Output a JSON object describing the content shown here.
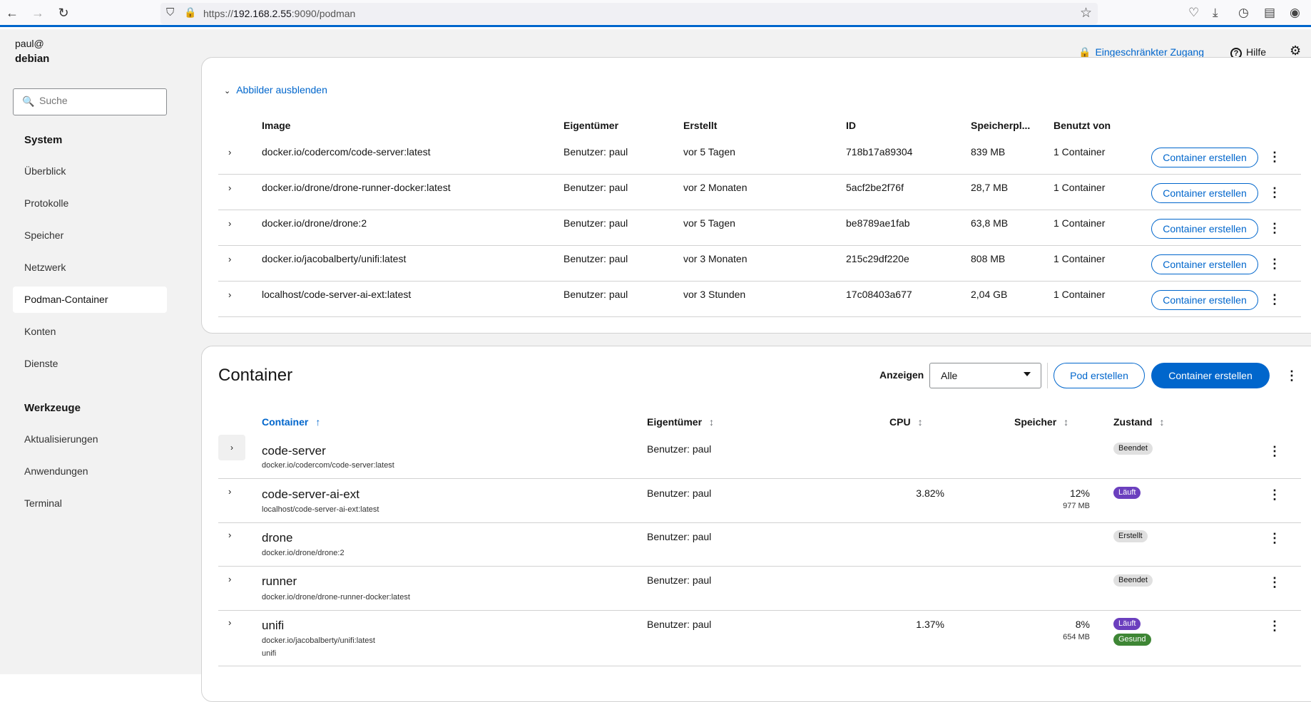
{
  "browser": {
    "url_prefix": "https://",
    "url_host": "192.168.2.55",
    "url_rest": ":9090/podman"
  },
  "header": {
    "user": "paul@",
    "host": "debian",
    "limited_access": "Eingeschränkter Zugang",
    "help": "Hilfe"
  },
  "sidebar": {
    "search_placeholder": "Suche",
    "section_system": "System",
    "items_system": [
      "Überblick",
      "Protokolle",
      "Speicher",
      "Netzwerk",
      "Podman-Container",
      "Konten",
      "Dienste"
    ],
    "section_tools": "Werkzeuge",
    "items_tools": [
      "Aktualisierungen",
      "Anwendungen",
      "Terminal"
    ]
  },
  "images": {
    "toggle_label": "Abbilder ausblenden",
    "columns": [
      "Image",
      "Eigentümer",
      "Erstellt",
      "ID",
      "Speicherpl...",
      "Benutzt von"
    ],
    "create_label": "Container erstellen",
    "rows": [
      {
        "image": "docker.io/codercom/code-server:latest",
        "owner": "Benutzer: paul",
        "created": "vor 5 Tagen",
        "id": "718b17a89304",
        "size": "839 MB",
        "used": "1 Container"
      },
      {
        "image": "docker.io/drone/drone-runner-docker:latest",
        "owner": "Benutzer: paul",
        "created": "vor 2 Monaten",
        "id": "5acf2be2f76f",
        "size": "28,7 MB",
        "used": "1 Container"
      },
      {
        "image": "docker.io/drone/drone:2",
        "owner": "Benutzer: paul",
        "created": "vor 5 Tagen",
        "id": "be8789ae1fab",
        "size": "63,8 MB",
        "used": "1 Container"
      },
      {
        "image": "docker.io/jacobalberty/unifi:latest",
        "owner": "Benutzer: paul",
        "created": "vor 3 Monaten",
        "id": "215c29df220e",
        "size": "808 MB",
        "used": "1 Container"
      },
      {
        "image": "localhost/code-server-ai-ext:latest",
        "owner": "Benutzer: paul",
        "created": "vor 3 Stunden",
        "id": "17c08403a677",
        "size": "2,04 GB",
        "used": "1 Container"
      }
    ]
  },
  "containers": {
    "title": "Container",
    "show_label": "Anzeigen",
    "filter_value": "Alle",
    "pod_button": "Pod erstellen",
    "create_button": "Container erstellen",
    "columns": [
      "Container",
      "Eigentümer",
      "CPU",
      "Speicher",
      "Zustand"
    ],
    "rows": [
      {
        "name": "code-server",
        "image": "docker.io/codercom/code-server:latest",
        "owner": "Benutzer: paul",
        "cpu": "",
        "mem": "",
        "mem_sub": "",
        "state": "Beendet",
        "health": "",
        "extra": ""
      },
      {
        "name": "code-server-ai-ext",
        "image": "localhost/code-server-ai-ext:latest",
        "owner": "Benutzer: paul",
        "cpu": "3.82%",
        "mem": "12%",
        "mem_sub": "977 MB",
        "state": "Läuft",
        "health": "",
        "extra": ""
      },
      {
        "name": "drone",
        "image": "docker.io/drone/drone:2",
        "owner": "Benutzer: paul",
        "cpu": "",
        "mem": "",
        "mem_sub": "",
        "state": "Erstellt",
        "health": "",
        "extra": ""
      },
      {
        "name": "runner",
        "image": "docker.io/drone/drone-runner-docker:latest",
        "owner": "Benutzer: paul",
        "cpu": "",
        "mem": "",
        "mem_sub": "",
        "state": "Beendet",
        "health": "",
        "extra": ""
      },
      {
        "name": "unifi",
        "image": "docker.io/jacobalberty/unifi:latest",
        "owner": "Benutzer: paul",
        "cpu": "1.37%",
        "mem": "8%",
        "mem_sub": "654 MB",
        "state": "Läuft",
        "health": "Gesund",
        "extra": "unifi"
      }
    ]
  },
  "colors": {
    "accent": "#0066cc",
    "running": "#6b3fbe",
    "healthy": "#3e8635",
    "lock": "#f0ab00"
  }
}
